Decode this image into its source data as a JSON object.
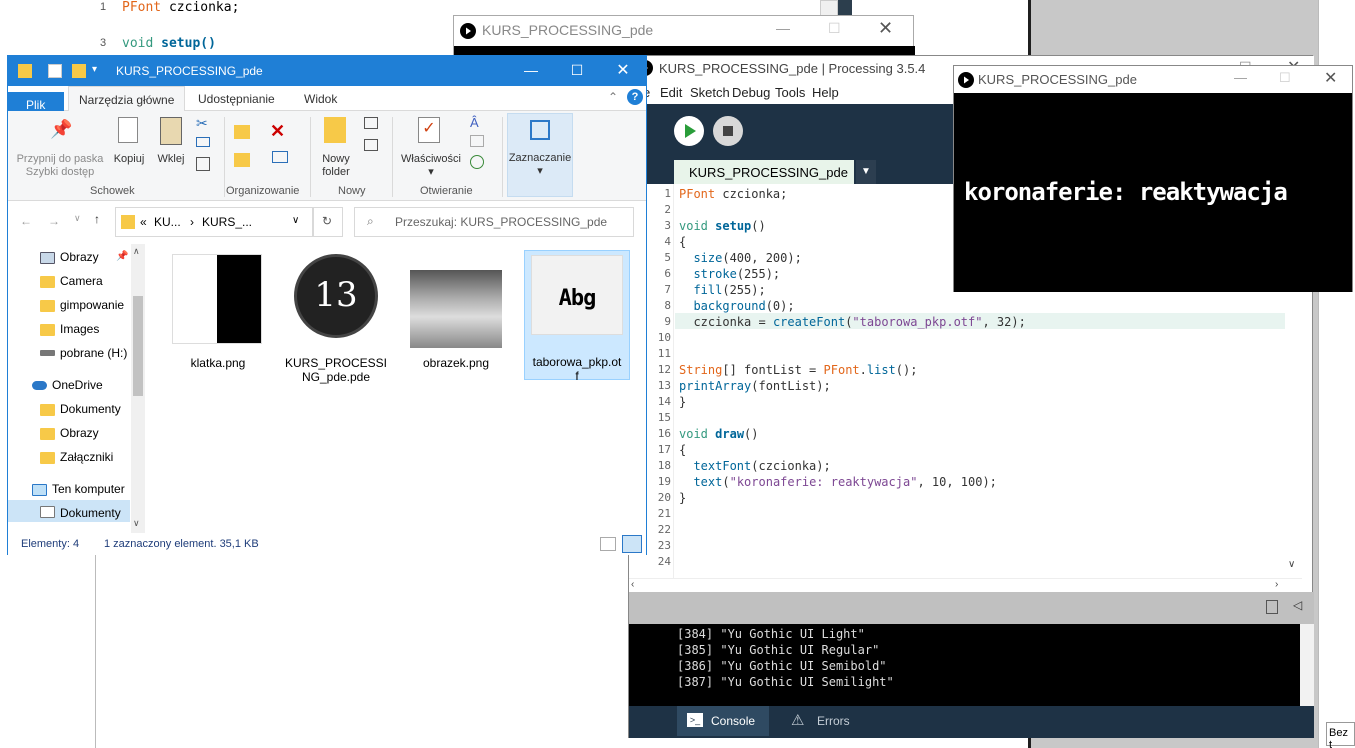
{
  "bg_editor": {
    "lines": [
      {
        "num": "1",
        "code_kw": "PFont",
        "code_rest": " czcionka;"
      },
      {
        "num": "3",
        "code_kw": "void",
        "code_rest": " setup()"
      }
    ]
  },
  "sketch_back": {
    "title": "KURS_PROCESSING_pde"
  },
  "ide": {
    "title": "KURS_PROCESSING_pde | Processing 3.5.4",
    "menu": [
      "e",
      "Edit",
      "Sketch",
      "Debug",
      "Tools",
      "Help"
    ],
    "tab": "KURS_PROCESSING_pde",
    "line_numbers": [
      "1",
      "2",
      "3",
      "4",
      "5",
      "6",
      "7",
      "8",
      "9",
      "10",
      "11",
      "12",
      "13",
      "14",
      "15",
      "16",
      "17",
      "18",
      "19",
      "20",
      "21",
      "22",
      "23",
      "24"
    ],
    "console_lines": [
      "[384] \"Yu Gothic UI Light\"",
      "[385] \"Yu Gothic UI Regular\"",
      "[386] \"Yu Gothic UI Semibold\"",
      "[387] \"Yu Gothic UI Semilight\""
    ],
    "console_tab": "Console",
    "errors_tab": "Errors"
  },
  "code": {
    "l1_type": "PFont",
    "l1_rest": " czcionka;",
    "l3_type": "void",
    "l3_fn": "setup",
    "l3_rest": "()",
    "l4": "{",
    "l5_fn": "size",
    "l5_rest": "(400, 200);",
    "l6_fn": "stroke",
    "l6_rest": "(255);",
    "l7_fn": "fill",
    "l7_rest": "(255);",
    "l8_fn": "background",
    "l8_rest": "(0);",
    "l9_pre": "czcionka = ",
    "l9_fn": "createFont",
    "l9_open": "(",
    "l9_str": "\"taborowa_pkp.otf\"",
    "l9_rest": ", 32);",
    "l12_type": "String",
    "l12_mid": "[] fontList = ",
    "l12_cls": "PFont",
    "l12_dot": ".",
    "l12_fn": "list",
    "l12_rest": "();",
    "l13_fn": "printArray",
    "l13_rest": "(fontList);",
    "l14": "}",
    "l16_type": "void",
    "l16_fn": "draw",
    "l16_rest": "()",
    "l17": "{",
    "l18_fn": "textFont",
    "l18_rest": "(czcionka);",
    "l19_fn": "text",
    "l19_open": "(",
    "l19_str": "\"koronaferie: reaktywacja\"",
    "l19_rest": ", 10, 100);",
    "l20": "}"
  },
  "output_window": {
    "title": "KURS_PROCESSING_pde",
    "text": "koronaferie: reaktywacja"
  },
  "explorer": {
    "title": "KURS_PROCESSING_pde",
    "tabs": {
      "file": "Plik",
      "home": "Narzędzia główne",
      "share": "Udostępnianie",
      "view": "Widok"
    },
    "ribbon": {
      "pin_line1": "Przypnij do paska",
      "pin_line2": "Szybki dostęp",
      "copy": "Kopiuj",
      "paste": "Wklej",
      "group_clipboard": "Schowek",
      "group_organize": "Organizowanie",
      "new_folder_line1": "Nowy",
      "new_folder_line2": "folder",
      "group_new": "Nowy",
      "properties": "Właściwości",
      "group_open": "Otwieranie",
      "select": "Zaznaczanie"
    },
    "address": {
      "prefix": "«",
      "part1": "KU...",
      "sep": "›",
      "part2": "KURS_..."
    },
    "search_placeholder": "Przeszukaj: KURS_PROCESSING_pde",
    "nav": [
      "Obrazy",
      "Camera",
      "gimpowanie",
      "Images",
      "pobrane (H:)",
      "OneDrive",
      "Dokumenty",
      "Obrazy",
      "Załączniki",
      "Ten komputer",
      "Dokumenty"
    ],
    "files": [
      {
        "name": "klatka.png"
      },
      {
        "name_line1": "KURS_PROCESSI",
        "name_line2": "NG_pde.pde"
      },
      {
        "name": "obrazek.png"
      },
      {
        "name_line1": "taborowa_pkp.ot",
        "name_line2": "f",
        "preview": "Abg"
      }
    ],
    "pde_icon_glyph": "13",
    "status": {
      "count": "Elementy: 4",
      "selection": "1 zaznaczony element. 35,1 KB"
    }
  },
  "right_strip": {
    "bottom_text": "Bez t"
  },
  "colors": {
    "ide_dark": "#1e3245",
    "explorer_blue": "#1f7fd6",
    "run_green": "#2a9d3a"
  }
}
